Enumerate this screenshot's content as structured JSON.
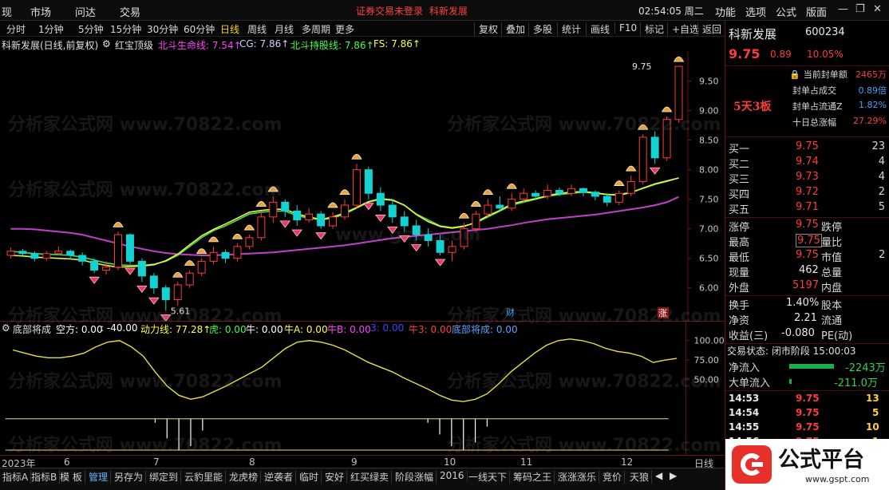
{
  "menu": {
    "items": [
      "现",
      "市场",
      "问达",
      "交易"
    ],
    "login_status": "证券交易未登录",
    "stock_tag": "科新发展",
    "clock": "02:54:05 周二",
    "right_items": [
      "功能",
      "选项",
      "公式",
      "版面"
    ]
  },
  "toolbar": {
    "periods": [
      "分时",
      "1分钟",
      "5分钟",
      "15分钟",
      "30分钟",
      "60分钟",
      "日线",
      "周线",
      "月线",
      "多周期",
      "更多"
    ],
    "active_period": "日线",
    "buttons": [
      "复权",
      "叠加",
      "多股",
      "统计",
      "画线",
      "F10",
      "标记",
      "+自选",
      "返回"
    ]
  },
  "legend": {
    "title": "科新发展(日线,前复权)",
    "indicator": "红宝顶级",
    "items": [
      {
        "label": "北斗生命线: 7.54↑",
        "color": "#ff40ff"
      },
      {
        "label": "CG: 7.86↑",
        "color": "#d0d0ff"
      },
      {
        "label": "北斗持股线: 7.86↑",
        "color": "#40ff40"
      },
      {
        "label": "FS: 7.86↑",
        "color": "#ffff40"
      }
    ]
  },
  "annotations": {
    "high_label": "9.75",
    "low_label": "5.61",
    "cai_badge": "财",
    "zhang_badge": "涨"
  },
  "colors": {
    "up": "#ff3b3b",
    "down": "#14d2d2",
    "life_line": "#c040c8",
    "hold_line": "#40e060",
    "fs_line": "#f0f040",
    "ind_line": "#e8e040",
    "bg": "#000000"
  },
  "chart_data": [
    {
      "type": "candlestick",
      "title": "科新发展(日线,前复权)",
      "ylim": [
        5.55,
        9.9
      ],
      "y_ticks": [
        6.0,
        6.5,
        7.0,
        7.5,
        8.0,
        8.5,
        9.0,
        9.5
      ],
      "x_labels": [
        "2023年",
        "6",
        "7",
        "8",
        "9",
        "10",
        "11",
        "12"
      ],
      "series": [
        {
          "name": "北斗生命线",
          "values": [
            7.0,
            7.0,
            6.99,
            6.97,
            6.95,
            6.93,
            6.9,
            6.85,
            6.8,
            6.75,
            6.7,
            6.66,
            6.62,
            6.59,
            6.57,
            6.56,
            6.55,
            6.55,
            6.56,
            6.57,
            6.58,
            6.59,
            6.6,
            6.62,
            6.64,
            6.66,
            6.68,
            6.7,
            6.72,
            6.75,
            6.78,
            6.81,
            6.84,
            6.86,
            6.88,
            6.9,
            6.92,
            6.94,
            6.96,
            6.98,
            7.0,
            7.03,
            7.06,
            7.1,
            7.13,
            7.16,
            7.18,
            7.2,
            7.22,
            7.24,
            7.27,
            7.3,
            7.33,
            7.36,
            7.4,
            7.45,
            7.54
          ]
        },
        {
          "name": "北斗持股线",
          "values": [
            6.62,
            6.6,
            6.58,
            6.57,
            6.56,
            6.55,
            6.52,
            6.47,
            6.42,
            6.39,
            6.38,
            6.38,
            6.4,
            6.45,
            6.55,
            6.7,
            6.85,
            6.97,
            7.05,
            7.15,
            7.25,
            7.28,
            7.3,
            7.3,
            7.22,
            7.18,
            7.15,
            7.18,
            7.25,
            7.35,
            7.45,
            7.5,
            7.48,
            7.4,
            7.25,
            7.15,
            7.05,
            7.02,
            7.05,
            7.1,
            7.2,
            7.3,
            7.4,
            7.45,
            7.5,
            7.55,
            7.58,
            7.6,
            7.62,
            7.6,
            7.58,
            7.58,
            7.62,
            7.68,
            7.75,
            7.8,
            7.86
          ]
        },
        {
          "name": "FS",
          "values": [
            6.55,
            6.54,
            6.52,
            6.51,
            6.5,
            6.49,
            6.47,
            6.42,
            6.38,
            6.35,
            6.36,
            6.37,
            6.39,
            6.46,
            6.57,
            6.73,
            6.88,
            6.99,
            7.08,
            7.18,
            7.28,
            7.31,
            7.33,
            7.33,
            7.25,
            7.2,
            7.16,
            7.2,
            7.27,
            7.36,
            7.46,
            7.51,
            7.49,
            7.4,
            7.24,
            7.12,
            7.04,
            7.01,
            7.04,
            7.11,
            7.22,
            7.31,
            7.42,
            7.47,
            7.51,
            7.56,
            7.6,
            7.62,
            7.63,
            7.61,
            7.58,
            7.57,
            7.61,
            7.69,
            7.76,
            7.81,
            7.86
          ]
        }
      ],
      "candles": [
        [
          6.55,
          6.62,
          6.68,
          6.5
        ],
        [
          6.62,
          6.58,
          6.66,
          6.52
        ],
        [
          6.58,
          6.5,
          6.62,
          6.45
        ],
        [
          6.5,
          6.58,
          6.62,
          6.46
        ],
        [
          6.58,
          6.62,
          6.7,
          6.55
        ],
        [
          6.62,
          6.55,
          6.65,
          6.48
        ],
        [
          6.55,
          6.45,
          6.6,
          6.38
        ],
        [
          6.45,
          6.3,
          6.5,
          6.25
        ],
        [
          6.3,
          6.35,
          6.45,
          6.22
        ],
        [
          6.35,
          6.9,
          6.95,
          6.3
        ],
        [
          6.9,
          6.45,
          6.92,
          6.4
        ],
        [
          6.45,
          6.2,
          6.5,
          6.1
        ],
        [
          6.2,
          6.0,
          6.25,
          5.9
        ],
        [
          6.0,
          5.8,
          6.05,
          5.61
        ],
        [
          5.8,
          6.05,
          6.1,
          5.7
        ],
        [
          6.05,
          6.25,
          6.3,
          6.0
        ],
        [
          6.25,
          6.45,
          6.5,
          6.2
        ],
        [
          6.45,
          6.6,
          6.7,
          6.4
        ],
        [
          6.6,
          6.5,
          6.65,
          6.42
        ],
        [
          6.5,
          6.7,
          6.75,
          6.45
        ],
        [
          6.7,
          6.85,
          6.9,
          6.65
        ],
        [
          6.85,
          7.2,
          7.3,
          6.8
        ],
        [
          7.2,
          7.45,
          7.55,
          7.1
        ],
        [
          7.45,
          7.3,
          7.5,
          7.2
        ],
        [
          7.3,
          7.15,
          7.4,
          7.05
        ],
        [
          7.15,
          7.25,
          7.35,
          7.1
        ],
        [
          7.25,
          7.05,
          7.3,
          7.0
        ],
        [
          7.05,
          7.2,
          7.28,
          7.0
        ],
        [
          7.2,
          7.4,
          7.5,
          7.15
        ],
        [
          7.4,
          8.0,
          8.1,
          7.35
        ],
        [
          8.0,
          7.6,
          8.05,
          7.5
        ],
        [
          7.6,
          7.4,
          7.7,
          7.3
        ],
        [
          7.4,
          7.2,
          7.5,
          7.1
        ],
        [
          7.2,
          7.05,
          7.3,
          6.95
        ],
        [
          7.05,
          6.9,
          7.15,
          6.8
        ],
        [
          6.9,
          6.8,
          7.0,
          6.7
        ],
        [
          6.8,
          6.6,
          6.9,
          6.55
        ],
        [
          6.6,
          6.7,
          6.8,
          6.45
        ],
        [
          6.7,
          7.0,
          7.1,
          6.65
        ],
        [
          7.0,
          7.25,
          7.3,
          6.95
        ],
        [
          7.25,
          7.4,
          7.5,
          7.2
        ],
        [
          7.4,
          7.35,
          7.55,
          7.3
        ],
        [
          7.35,
          7.5,
          7.6,
          7.3
        ],
        [
          7.5,
          7.6,
          7.68,
          7.45
        ],
        [
          7.6,
          7.55,
          7.65,
          7.5
        ],
        [
          7.55,
          7.65,
          7.75,
          7.5
        ],
        [
          7.65,
          7.6,
          7.7,
          7.55
        ],
        [
          7.6,
          7.68,
          7.75,
          7.55
        ],
        [
          7.68,
          7.62,
          7.7,
          7.55
        ],
        [
          7.62,
          7.55,
          7.65,
          7.48
        ],
        [
          7.55,
          7.45,
          7.6,
          7.38
        ],
        [
          7.45,
          7.6,
          7.65,
          7.4
        ],
        [
          7.6,
          7.8,
          7.9,
          7.55
        ],
        [
          7.8,
          8.55,
          8.6,
          7.75
        ],
        [
          8.55,
          8.2,
          8.65,
          8.1
        ],
        [
          8.2,
          8.85,
          8.9,
          8.15
        ],
        [
          8.85,
          9.75,
          9.75,
          8.8
        ]
      ]
    },
    {
      "type": "line",
      "title": "底部将成",
      "ylim": [
        0,
        110
      ],
      "y_ticks": [
        50.0,
        75.0,
        100.0
      ],
      "legend": [
        {
          "label": "空方: 0.00",
          "color": "#ffffff"
        },
        {
          "label": ": -40.00",
          "color": "#ffffff"
        },
        {
          "label": "动力线: 77.28↑",
          "color": "#ffff40"
        },
        {
          "label": "虎: 0.00",
          "color": "#40ff40"
        },
        {
          "label": "牛: 0.00",
          "color": "#ffffff"
        },
        {
          "label": "牛A: 0.00",
          "color": "#ffff40"
        },
        {
          "label": "牛B: 0.00",
          "color": "#ff40ff"
        },
        {
          "label": "3: 0.00",
          "color": "#4040ff"
        },
        {
          "label": "牛3: 0.00",
          "color": "#ff4040"
        },
        {
          "label": "底部将成: 0.00",
          "color": "#60a0ff"
        }
      ],
      "series": [
        {
          "name": "动力线",
          "values": [
            88,
            84,
            80,
            78,
            78,
            80,
            84,
            92,
            98,
            100,
            92,
            80,
            60,
            42,
            30,
            25,
            28,
            35,
            42,
            50,
            58,
            66,
            78,
            90,
            98,
            100,
            98,
            94,
            88,
            80,
            72,
            66,
            60,
            52,
            45,
            38,
            30,
            24,
            22,
            25,
            32,
            45,
            60,
            72,
            84,
            94,
            100,
            102,
            100,
            96,
            90,
            86,
            84,
            80,
            72,
            75,
            77.28
          ]
        },
        {
          "name": "空方",
          "values": [
            0,
            0,
            0,
            0,
            0,
            0,
            0,
            0,
            0,
            0,
            0,
            0,
            -5,
            -25,
            -40,
            -35,
            -15,
            0,
            0,
            0,
            0,
            0,
            0,
            0,
            0,
            0,
            0,
            0,
            0,
            0,
            0,
            0,
            0,
            0,
            0,
            -5,
            -20,
            -35,
            -40,
            -30,
            -10,
            0,
            0,
            0,
            0,
            0,
            0,
            0,
            0,
            0,
            0,
            0,
            0,
            0,
            0,
            0,
            0
          ]
        }
      ]
    }
  ],
  "xaxis": {
    "labels": [
      "2023年",
      "6",
      "7",
      "8",
      "9",
      "10",
      "11",
      "12"
    ],
    "corner": "日线"
  },
  "bottom_tabs": {
    "items": [
      "指标A",
      "指标B",
      "模 板",
      "管理",
      "另存为",
      "绑定到",
      "云豹里能",
      "龙虎榜",
      "逆袭者",
      "临时",
      "安好",
      "红买绿卖",
      "阶段涨幅",
      "2016",
      "一线天下",
      "筹码之王",
      "涨涨涨乐",
      "竞价",
      "天狼"
    ],
    "active": "管理"
  },
  "panel": {
    "name": "科新发展",
    "code": "600234",
    "price": "9.75",
    "change": "0.89",
    "pct": "10.05%",
    "streak": "5天3板",
    "seal": [
      {
        "label": "当前封单额",
        "value": "2465万"
      },
      {
        "label": "封单占成交",
        "value": "0.89倍"
      },
      {
        "label": "封单占流通Z",
        "value": "1.82%"
      },
      {
        "label": "十日总涨幅",
        "value": "27.29%"
      }
    ],
    "orderbook": [
      {
        "label": "买一",
        "price": "9.75",
        "vol": "23"
      },
      {
        "label": "买二",
        "price": "9.74",
        "vol": "4"
      },
      {
        "label": "买三",
        "price": "9.73",
        "vol": "4"
      },
      {
        "label": "买四",
        "price": "9.72",
        "vol": "2"
      },
      {
        "label": "买五",
        "price": "9.71",
        "vol": "5"
      }
    ],
    "stats": [
      {
        "l1": "涨停",
        "v1": "9.75",
        "l2": "跌停",
        "v2": ""
      },
      {
        "l1": "最高",
        "v1": "9.75",
        "l2": "量比",
        "v2": ""
      },
      {
        "l1": "最低",
        "v1": "9.75",
        "l2": "市值",
        "v2": "2"
      },
      {
        "l1": "现量",
        "v1": "462",
        "l2": "总量",
        "v2": ""
      },
      {
        "l1": "外盘",
        "v1": "5197",
        "l2": "内盘",
        "v2": ""
      }
    ],
    "stats2": [
      {
        "l1": "换手",
        "v1": "1.40%",
        "l2": "股本",
        "v2": ""
      },
      {
        "l1": "净资",
        "v1": "2.21",
        "l2": "流通",
        "v2": ""
      },
      {
        "l1": "收益(三)",
        "v1": "-0.080",
        "l2": "PE(动)",
        "v2": ""
      }
    ],
    "trade_state": "交易状态: 闭市阶段 15:00:03",
    "flows": [
      {
        "label": "净流入",
        "value": "-2243万",
        "level": 0.85
      },
      {
        "label": "大单流入",
        "value": "-211.0万",
        "level": 0.05
      }
    ],
    "ticks": [
      {
        "time": "14:53",
        "price": "9.75",
        "vol": "13"
      },
      {
        "time": "14:54",
        "price": "9.75",
        "vol": "5"
      },
      {
        "time": "14:55",
        "price": "9.75",
        "vol": "10"
      },
      {
        "time": "14:56",
        "price": "9.75",
        "vol": "1"
      }
    ]
  },
  "logo": {
    "text": "公式平台",
    "url": "www.gspt.com"
  },
  "watermarks": {
    "site1": "分析家公式网 www.70822.com",
    "site2": "www.gspt.com"
  }
}
